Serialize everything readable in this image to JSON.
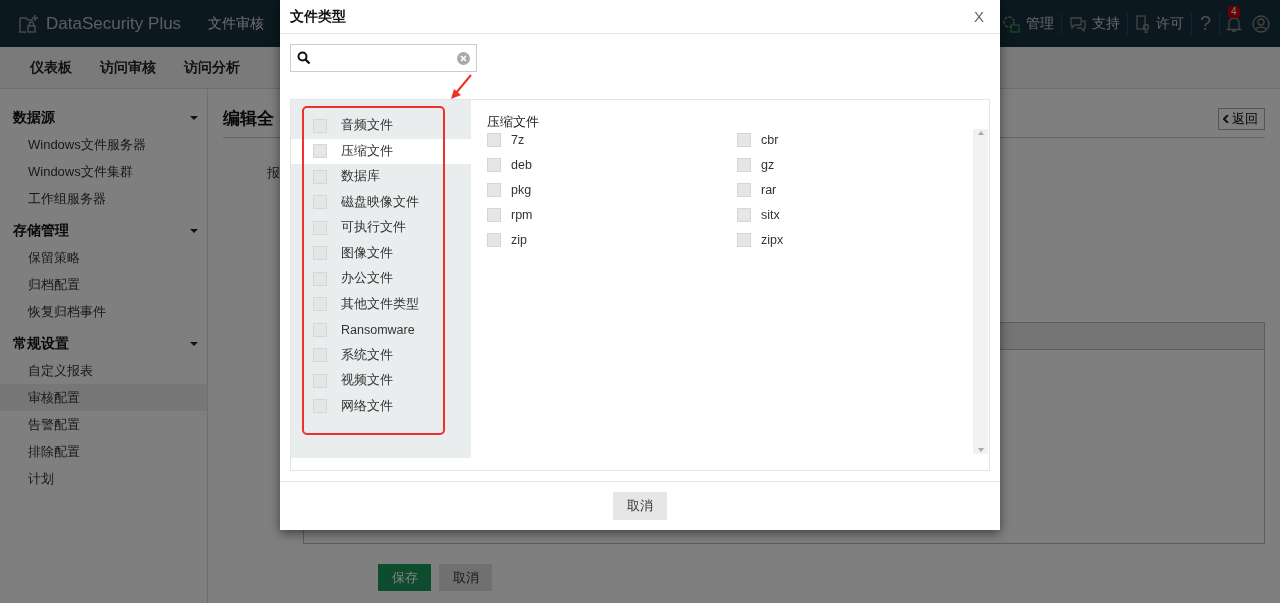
{
  "header": {
    "logo": "DataSecurity Plus",
    "menu": "文件审核",
    "actions": [
      {
        "kind": "admin",
        "label": "管理"
      },
      {
        "kind": "support",
        "label": "支持"
      },
      {
        "kind": "license",
        "label": "许可"
      },
      {
        "kind": "help",
        "label": "?"
      }
    ],
    "badge": "4"
  },
  "nav": {
    "items": [
      "仪表板",
      "访问审核",
      "访问分析"
    ]
  },
  "sidebar": {
    "groups": [
      {
        "title": "数据源",
        "expanded": true,
        "items": [
          {
            "label": "Windows文件服务器",
            "selected": false
          },
          {
            "label": "Windows文件集群",
            "selected": false
          },
          {
            "label": "工作组服务器",
            "selected": false
          }
        ]
      },
      {
        "title": "存储管理",
        "expanded": true,
        "items": [
          {
            "label": "保留策略",
            "selected": false
          },
          {
            "label": "归档配置",
            "selected": false
          },
          {
            "label": "恢复归档事件",
            "selected": false
          }
        ]
      },
      {
        "title": "常规设置",
        "expanded": true,
        "items": [
          {
            "label": "自定义报表",
            "selected": false
          },
          {
            "label": "审核配置",
            "selected": true
          },
          {
            "label": "告警配置",
            "selected": false
          },
          {
            "label": "排除配置",
            "selected": false
          },
          {
            "label": "计划",
            "selected": false
          }
        ]
      }
    ]
  },
  "content": {
    "title": "编辑全",
    "field_label": "报",
    "back_button": "返回",
    "buttons": [
      {
        "label": "保存",
        "kind": "primary"
      },
      {
        "label": "取消",
        "kind": "secondary"
      }
    ]
  },
  "dialog": {
    "title": "文件类型",
    "close": "X",
    "categories": [
      {
        "label": "音频文件",
        "checked": false,
        "selected": false
      },
      {
        "label": "压缩文件",
        "checked": false,
        "selected": true
      },
      {
        "label": "数据库",
        "checked": false,
        "selected": false
      },
      {
        "label": "磁盘映像文件",
        "checked": false,
        "selected": false
      },
      {
        "label": "可执行文件",
        "checked": false,
        "selected": false
      },
      {
        "label": "图像文件",
        "checked": false,
        "selected": false
      },
      {
        "label": "办公文件",
        "checked": false,
        "selected": false
      },
      {
        "label": "其他文件类型",
        "checked": false,
        "selected": false
      },
      {
        "label": "Ransomware",
        "checked": false,
        "selected": false
      },
      {
        "label": "系统文件",
        "checked": false,
        "selected": false
      },
      {
        "label": "视频文件",
        "checked": false,
        "selected": false
      },
      {
        "label": "网络文件",
        "checked": false,
        "selected": false
      }
    ],
    "section_title": "压缩文件",
    "extensions": [
      {
        "label": "7z",
        "checked": false
      },
      {
        "label": "cbr",
        "checked": false
      },
      {
        "label": "deb",
        "checked": false
      },
      {
        "label": "gz",
        "checked": false
      },
      {
        "label": "pkg",
        "checked": false
      },
      {
        "label": "rar",
        "checked": false
      },
      {
        "label": "rpm",
        "checked": false
      },
      {
        "label": "sitx",
        "checked": false
      },
      {
        "label": "zip",
        "checked": false
      },
      {
        "label": "zipx",
        "checked": false
      }
    ],
    "cancel_button": "取消"
  }
}
